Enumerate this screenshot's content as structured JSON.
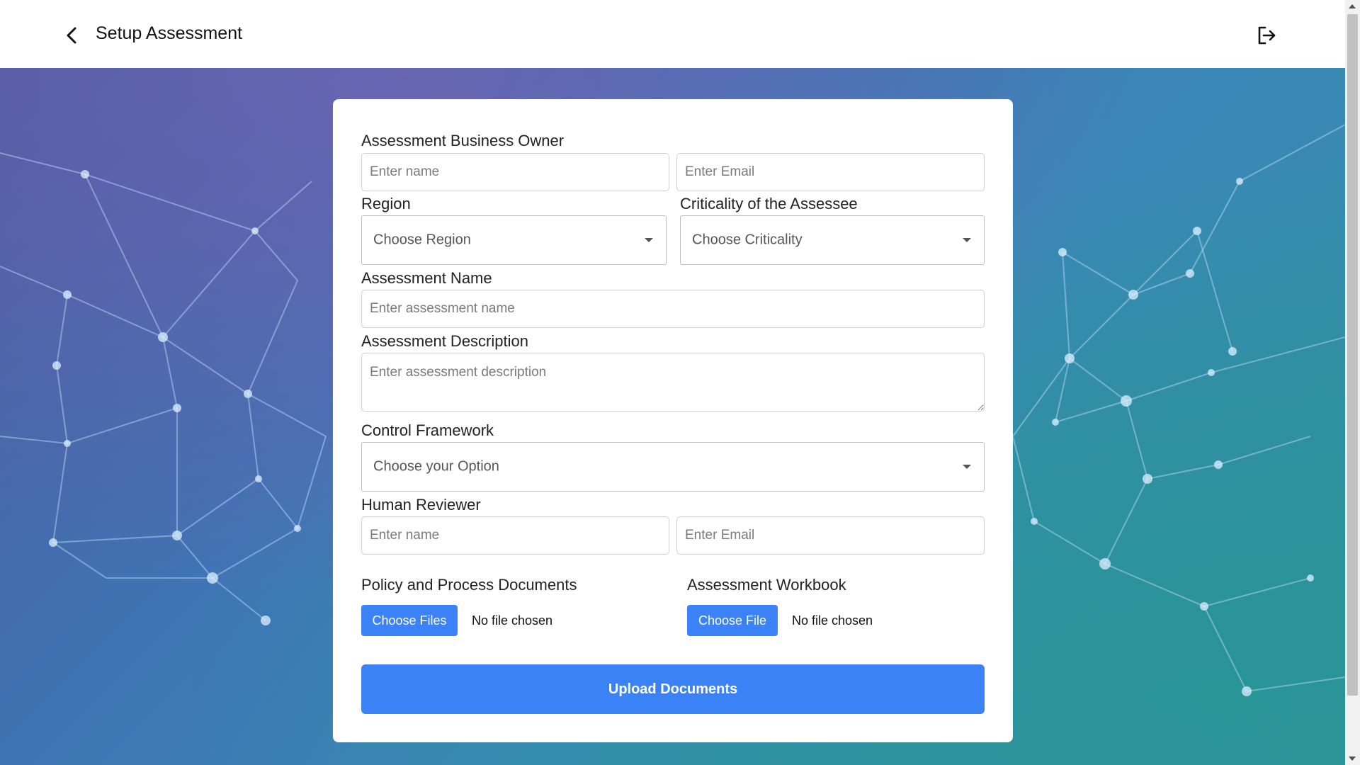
{
  "header": {
    "title": "Setup Assessment",
    "back_icon": "chevron-left-icon",
    "logout_icon": "logout-icon"
  },
  "form": {
    "business_owner": {
      "label": "Assessment Business Owner",
      "name_placeholder": "Enter name",
      "email_placeholder": "Enter Email"
    },
    "region": {
      "label": "Region",
      "value": "Choose Region"
    },
    "criticality": {
      "label": "Criticality of the Assessee",
      "value": "Choose Criticality"
    },
    "assessment_name": {
      "label": "Assessment Name",
      "placeholder": "Enter assessment name"
    },
    "assessment_description": {
      "label": "Assessment Description",
      "placeholder": "Enter assessment description"
    },
    "control_framework": {
      "label": "Control Framework",
      "value": "Choose your Option"
    },
    "human_reviewer": {
      "label": "Human Reviewer",
      "name_placeholder": "Enter name",
      "email_placeholder": "Enter Email"
    },
    "policy_documents": {
      "label": "Policy and Process Documents",
      "button_label": "Choose Files",
      "status": "No file chosen"
    },
    "assessment_workbook": {
      "label": "Assessment Workbook",
      "button_label": "Choose File",
      "status": "No file chosen"
    },
    "submit_label": "Upload Documents"
  },
  "colors": {
    "accent": "#3b82f6",
    "background_start": "#4d5a9e",
    "background_end": "#2f8f9a"
  }
}
